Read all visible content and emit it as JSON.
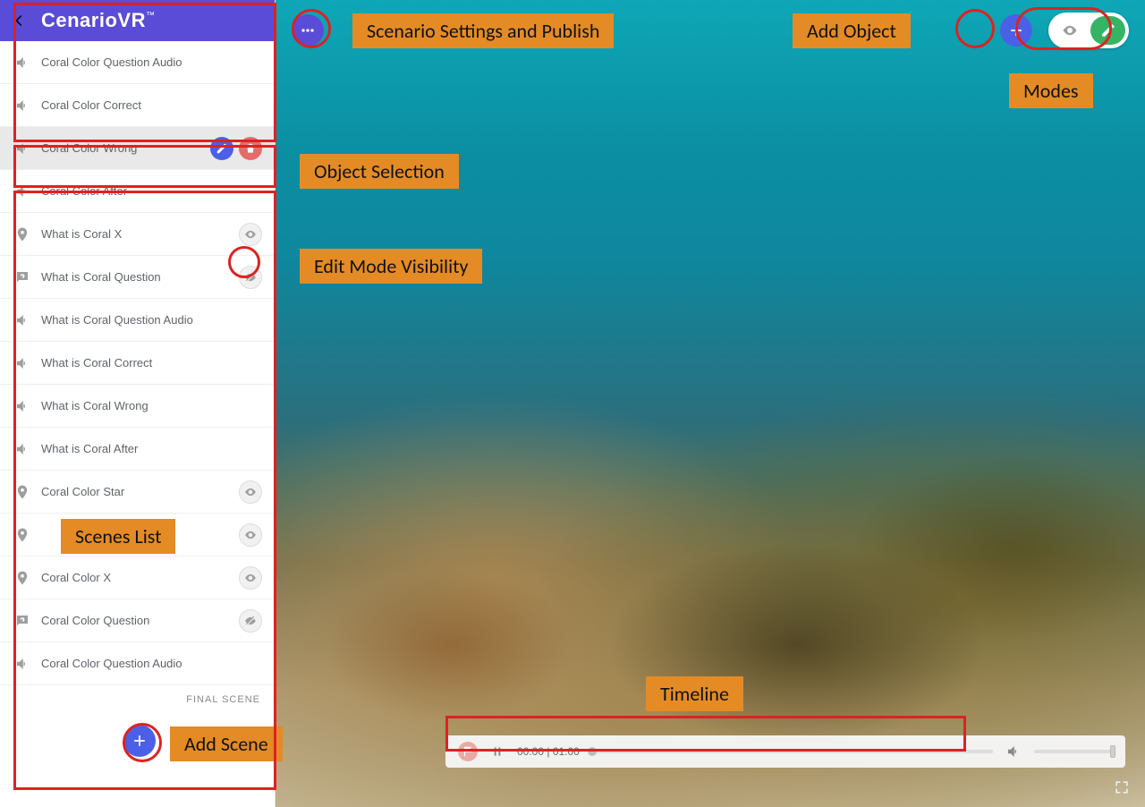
{
  "brand": "CenarioVR",
  "brand_tm": "™",
  "sidebar": {
    "final_scene_label": "FINAL SCENE",
    "items": [
      {
        "icon": "audio",
        "label": "Coral Color Question Audio"
      },
      {
        "icon": "audio",
        "label": "Coral Color Correct"
      },
      {
        "icon": "audio",
        "label": "Coral Color Wrong",
        "selected": true,
        "edit_delete": true
      },
      {
        "icon": "audio",
        "label": "Coral Color After"
      },
      {
        "icon": "marker",
        "label": "What is Coral X",
        "visibility": "visible"
      },
      {
        "icon": "question",
        "label": "What is Coral Question",
        "visibility": "hidden"
      },
      {
        "icon": "audio",
        "label": "What is Coral Question Audio"
      },
      {
        "icon": "audio",
        "label": "What is Coral Correct"
      },
      {
        "icon": "audio",
        "label": "What is Coral Wrong"
      },
      {
        "icon": "audio",
        "label": "What is Coral After"
      },
      {
        "icon": "marker",
        "label": "Coral Color Star",
        "visibility": "visible"
      },
      {
        "icon": "marker",
        "label": "",
        "visibility": "visible"
      },
      {
        "icon": "marker",
        "label": "Coral Color X",
        "visibility": "visible"
      },
      {
        "icon": "question",
        "label": "Coral Color Question",
        "visibility": "hidden"
      },
      {
        "icon": "audio",
        "label": "Coral Color Question Audio"
      }
    ]
  },
  "timeline": {
    "current": "00:00",
    "total": "01:00",
    "separator": " | "
  },
  "annotations": {
    "settings_publish": "Scenario Settings and Publish",
    "add_object": "Add Object",
    "modes": "Modes",
    "object_selection": "Object Selection",
    "edit_mode_visibility": "Edit Mode Visibility",
    "scenes_list": "Scenes List",
    "timeline": "Timeline",
    "add_scene": "Add Scene"
  },
  "icons": {
    "back": "arrow-left",
    "audio": "volume",
    "marker": "pin",
    "question": "chat-question",
    "eye": "eye",
    "eye_off": "eye-off",
    "edit": "pencil",
    "delete": "trash",
    "more": "dots",
    "add": "plus",
    "play_pause": "pause",
    "flag": "flag",
    "volume_ctrl": "volume",
    "fullscreen": "fullscreen"
  },
  "colors": {
    "brand_purple": "#5a4cd6",
    "accent_blue": "#4b60e6",
    "accent_green": "#35b564",
    "danger": "#e66b6b",
    "annotation": "#e48b25",
    "outline": "#d22"
  }
}
